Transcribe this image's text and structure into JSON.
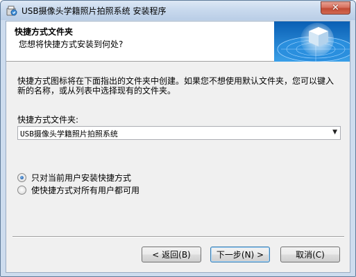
{
  "window": {
    "title": "USB摄像头学籍照片拍照系统 安装程序",
    "close_label": "✕"
  },
  "header": {
    "title": "快捷方式文件夹",
    "subtitle": "您想将快捷方式安装到何处?"
  },
  "body": {
    "description": "快捷方式图标将在下面指出的文件夹中创建。如果您不想使用默认文件夹，您可以键入新的名称，或从列表中选择现有的文件夹。",
    "folder_label": "快捷方式文件夹:",
    "folder_value": "USB摄像头学籍照片拍照系统"
  },
  "options": [
    {
      "label": "只对当前用户安装快捷方式",
      "selected": true
    },
    {
      "label": "使快捷方式对所有用户都可用",
      "selected": false
    }
  ],
  "buttons": {
    "back": "< 返回(B)",
    "next": "下一步(N) >",
    "cancel": "取消(C)"
  },
  "icons": {
    "app": "installer-icon",
    "header": "cube-globe-graphic",
    "dropdown": "chevron-down-icon"
  },
  "colors": {
    "titlebar": "#c9daee",
    "close": "#c24b35",
    "dialog_bg": "#f0f0f0",
    "radio_dot": "#2b67b0"
  }
}
